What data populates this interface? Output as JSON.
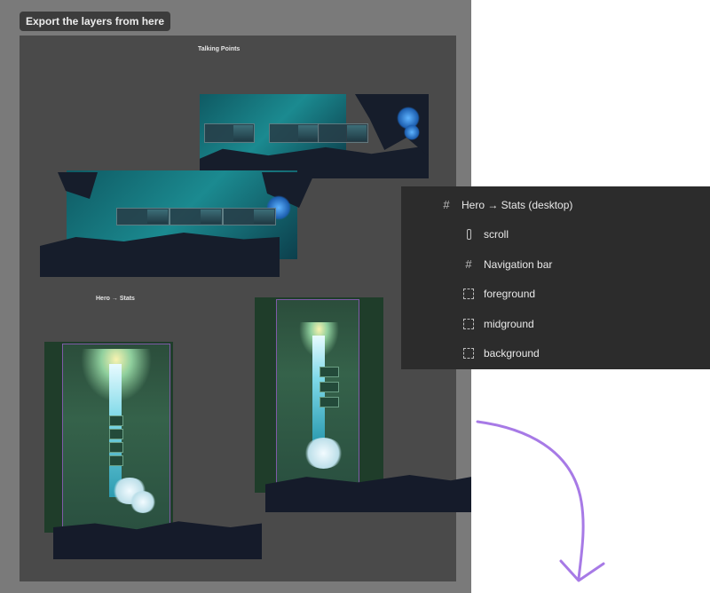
{
  "canvas": {
    "export_label": "Export the layers from here",
    "sections": {
      "talking_points_title": "Talking Points",
      "hero_stats_title": "Hero → Stats"
    }
  },
  "layers_panel": {
    "items": [
      {
        "label": "Hero → Stats (desktop)",
        "icon": "frame-icon"
      },
      {
        "label": "scroll",
        "icon": "scroll-icon"
      },
      {
        "label": "Navigation bar",
        "icon": "frame-icon"
      },
      {
        "label": "foreground",
        "icon": "group-icon"
      },
      {
        "label": "midground",
        "icon": "group-icon"
      },
      {
        "label": "background",
        "icon": "group-icon"
      }
    ]
  },
  "colors": {
    "canvas_gray": "#7a7a7a",
    "frame_dark": "#4a4a4a",
    "panel_bg": "#2c2c2c",
    "annotation_arrow": "#a77ae6",
    "selection_outline": "#7f5aa8"
  }
}
